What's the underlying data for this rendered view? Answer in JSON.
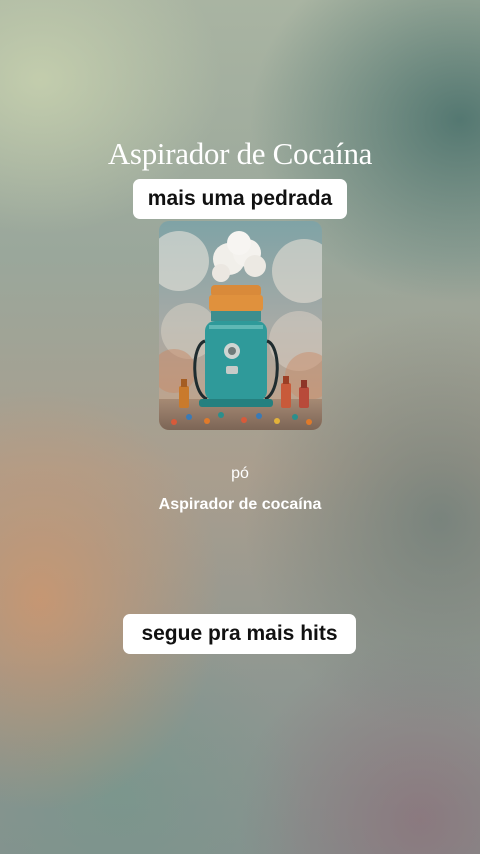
{
  "header": {
    "title": "Aspirador de Cocaína",
    "subtitle_pill": "mais uma pedrada"
  },
  "cover_art": {
    "description_icon": "vacuum-cleaner-artwork"
  },
  "track": {
    "genre": "pó",
    "name": "Aspirador de cocaína"
  },
  "footer": {
    "call_to_action": "segue pra mais hits"
  },
  "colors": {
    "text": "#ffffff",
    "pill_background": "#ffffff",
    "pill_text": "#111111",
    "vacuum_body": "#2f9a9a",
    "vacuum_top": "#d98a3a"
  }
}
